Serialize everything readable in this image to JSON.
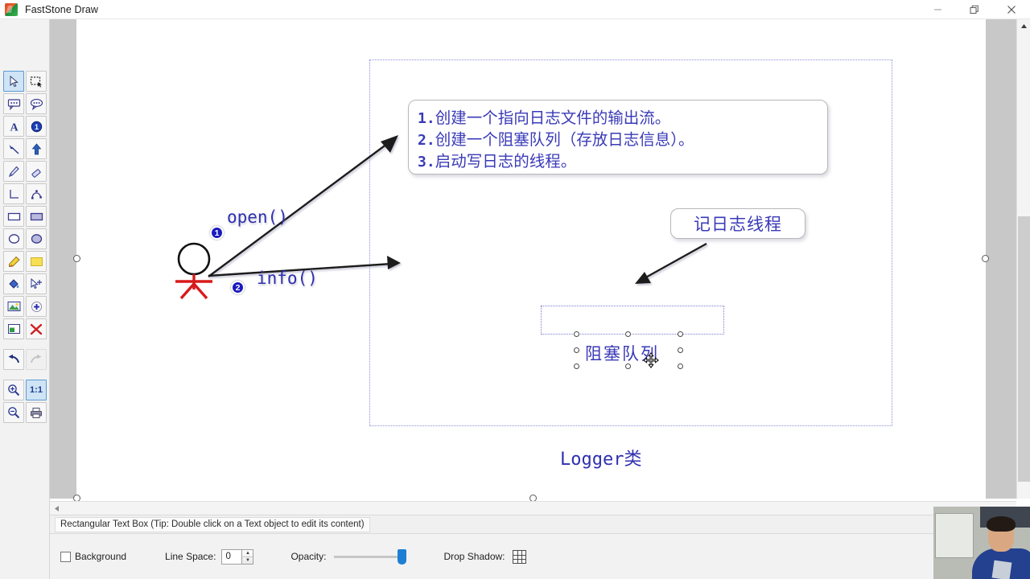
{
  "window": {
    "title": "FastStone Draw",
    "icon": "faststone-logo-icon",
    "minimize_label": "—",
    "restore_label": "❐",
    "close_label": "✕"
  },
  "toolbar": {
    "rows": [
      [
        {
          "name": "select-arrow-tool",
          "glyph": "arrow",
          "active": true
        },
        {
          "name": "marquee-select-tool",
          "glyph": "marquee",
          "active": false
        }
      ],
      [
        {
          "name": "rectangular-callout-tool",
          "glyph": "callout-rect",
          "active": false
        },
        {
          "name": "rounded-callout-tool",
          "glyph": "callout-ellipse",
          "active": false
        }
      ],
      [
        {
          "name": "text-tool",
          "glyph": "letter-a",
          "active": false
        },
        {
          "name": "number-badge-tool",
          "glyph": "badge-one",
          "active": false
        }
      ],
      [
        {
          "name": "arrow-line-tool",
          "glyph": "arrow-line",
          "active": false
        },
        {
          "name": "up-arrow-tool",
          "glyph": "up-arrow",
          "active": false
        }
      ],
      [
        {
          "name": "pencil-tool",
          "glyph": "pencil",
          "active": false
        },
        {
          "name": "eraser-tool",
          "glyph": "eraser",
          "active": false
        }
      ],
      [
        {
          "name": "line-tool",
          "glyph": "corner-line",
          "active": false
        },
        {
          "name": "polyline-tool",
          "glyph": "polyline",
          "active": false
        }
      ],
      [
        {
          "name": "rectangle-tool",
          "glyph": "rect-outline",
          "active": false
        },
        {
          "name": "filled-rectangle-tool",
          "glyph": "rect-filled",
          "active": false
        }
      ],
      [
        {
          "name": "ellipse-tool",
          "glyph": "ellipse-outline",
          "active": false
        },
        {
          "name": "filled-ellipse-tool",
          "glyph": "ellipse-filled",
          "active": false
        }
      ],
      [
        {
          "name": "highlighter-tool",
          "glyph": "highlighter",
          "active": false
        },
        {
          "name": "note-tool",
          "glyph": "sticky-note",
          "active": false
        }
      ],
      [
        {
          "name": "fill-bucket-tool",
          "glyph": "paint-bucket",
          "active": false
        },
        {
          "name": "clone-tool",
          "glyph": "cursor-plus",
          "active": false
        }
      ],
      [
        {
          "name": "insert-image-tool",
          "glyph": "image",
          "active": false
        },
        {
          "name": "add-object-tool",
          "glyph": "plus-circle",
          "active": false
        }
      ],
      [
        {
          "name": "crop-tool",
          "glyph": "crop",
          "active": false
        },
        {
          "name": "delete-tool",
          "glyph": "red-x",
          "active": false
        }
      ]
    ],
    "history_row": [
      {
        "name": "undo-button",
        "glyph": "undo",
        "enabled": true
      },
      {
        "name": "redo-button",
        "glyph": "redo",
        "enabled": false
      }
    ],
    "zoom_row_a": [
      {
        "name": "zoom-in-button",
        "glyph": "zoom-in",
        "active": false
      },
      {
        "name": "zoom-actual-size-button",
        "glyph": "one-to-one",
        "label": "1:1",
        "active": true
      }
    ],
    "zoom_row_b": [
      {
        "name": "zoom-out-button",
        "glyph": "zoom-out",
        "active": false
      },
      {
        "name": "print-button",
        "glyph": "printer",
        "active": false
      }
    ]
  },
  "canvas": {
    "steps_callout": {
      "lines": [
        {
          "num": "1.",
          "text": "创建一个指向日志文件的输出流。"
        },
        {
          "num": "2.",
          "text": "创建一个阻塞队列（存放日志信息）。"
        },
        {
          "num": "3.",
          "text": "启动写日志的线程。"
        }
      ]
    },
    "thread_callout": "记日志线程",
    "selected_text": "阻塞队列",
    "group_label": "Logger类",
    "call_labels": [
      {
        "badge": "1",
        "text": "open()"
      },
      {
        "badge": "2",
        "text": "info()"
      }
    ]
  },
  "statusbar": {
    "message": "Rectangular Text Box (Tip: Double click on a Text object to edit its content)"
  },
  "properties": {
    "background_label": "Background",
    "background_checked": false,
    "line_space_label": "Line Space:",
    "line_space_value": "0",
    "opacity_label": "Opacity:",
    "opacity_value": 88,
    "drop_shadow_label": "Drop Shadow:"
  },
  "colors": {
    "accent_blue": "#2f2fae",
    "badge_blue": "#1a1ac0",
    "selection_dotted": "#7b7bd0",
    "slider_blue": "#1e7fd4",
    "canvas_gray": "#c8c8c8"
  }
}
